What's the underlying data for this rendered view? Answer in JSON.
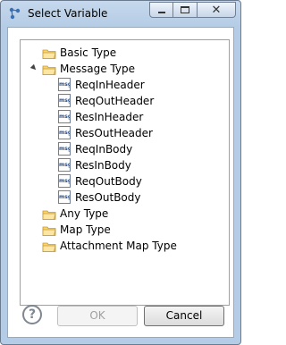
{
  "window": {
    "title": "Select Variable"
  },
  "tree": [
    {
      "label": "Basic Type",
      "type": "folder"
    },
    {
      "label": "Message Type",
      "type": "folder",
      "expanded": true
    },
    {
      "label": "ReqInHeader",
      "type": "msg"
    },
    {
      "label": "ReqOutHeader",
      "type": "msg"
    },
    {
      "label": "ResInHeader",
      "type": "msg"
    },
    {
      "label": "ResOutHeader",
      "type": "msg"
    },
    {
      "label": "ReqInBody",
      "type": "msg"
    },
    {
      "label": "ResInBody",
      "type": "msg"
    },
    {
      "label": "ReqOutBody",
      "type": "msg"
    },
    {
      "label": "ResOutBody",
      "type": "msg"
    },
    {
      "label": "Any Type",
      "type": "folder"
    },
    {
      "label": "Map Type",
      "type": "folder"
    },
    {
      "label": "Attachment Map Type",
      "type": "folder"
    }
  ],
  "icons": {
    "msg_text": "msg",
    "help_glyph": "?"
  },
  "buttons": {
    "ok": "OK",
    "cancel": "Cancel"
  }
}
